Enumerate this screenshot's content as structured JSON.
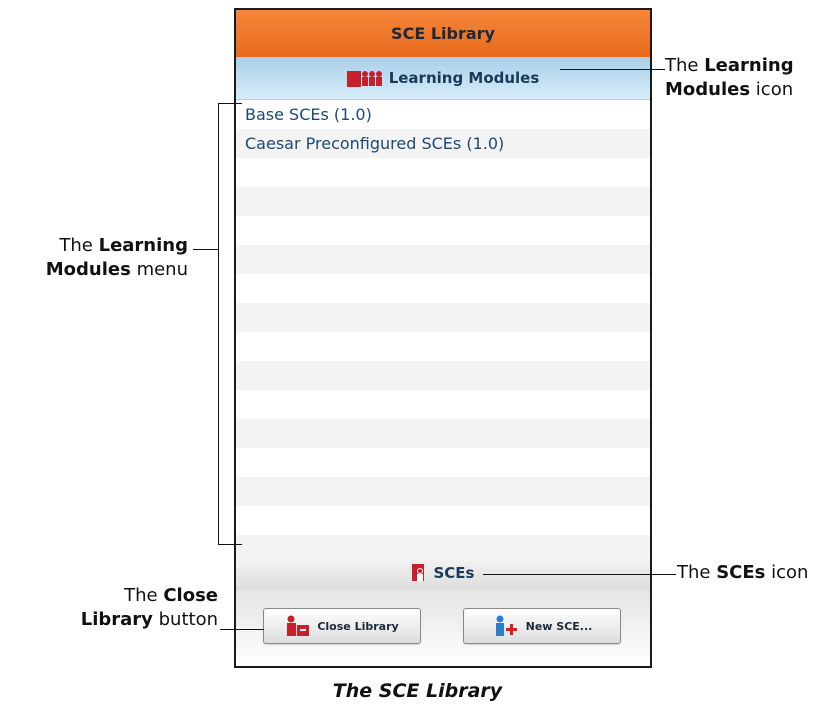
{
  "window": {
    "title": "SCE Library"
  },
  "learning_modules": {
    "header_label": "Learning Modules",
    "items": [
      "Base SCEs (1.0)",
      "Caesar Preconfigured SCEs (1.0)",
      "",
      "",
      "",
      "",
      "",
      "",
      "",
      "",
      "",
      "",
      "",
      "",
      "",
      ""
    ]
  },
  "sces": {
    "header_label": "SCEs"
  },
  "buttons": {
    "close_library": "Close Library",
    "new_sce": "New SCE..."
  },
  "annotations": {
    "lm_icon": {
      "pre": "The ",
      "bold": "Learning",
      "bold2": "Modules",
      "post": " icon"
    },
    "lm_menu": {
      "pre": "The ",
      "bold": "Learning",
      "bold2": "Modules",
      "post": " menu"
    },
    "sces_icon": {
      "pre": "The ",
      "bold": "SCEs",
      "post": " icon"
    },
    "close_btn": {
      "pre": "The ",
      "bold": "Close",
      "bold2": "Library",
      "post": " button"
    }
  },
  "caption": "The SCE Library",
  "colors": {
    "title_bar": "#e86a1c",
    "section_header": "#bfdff2",
    "icon_red": "#c8202a",
    "link_text": "#1c4a72"
  }
}
